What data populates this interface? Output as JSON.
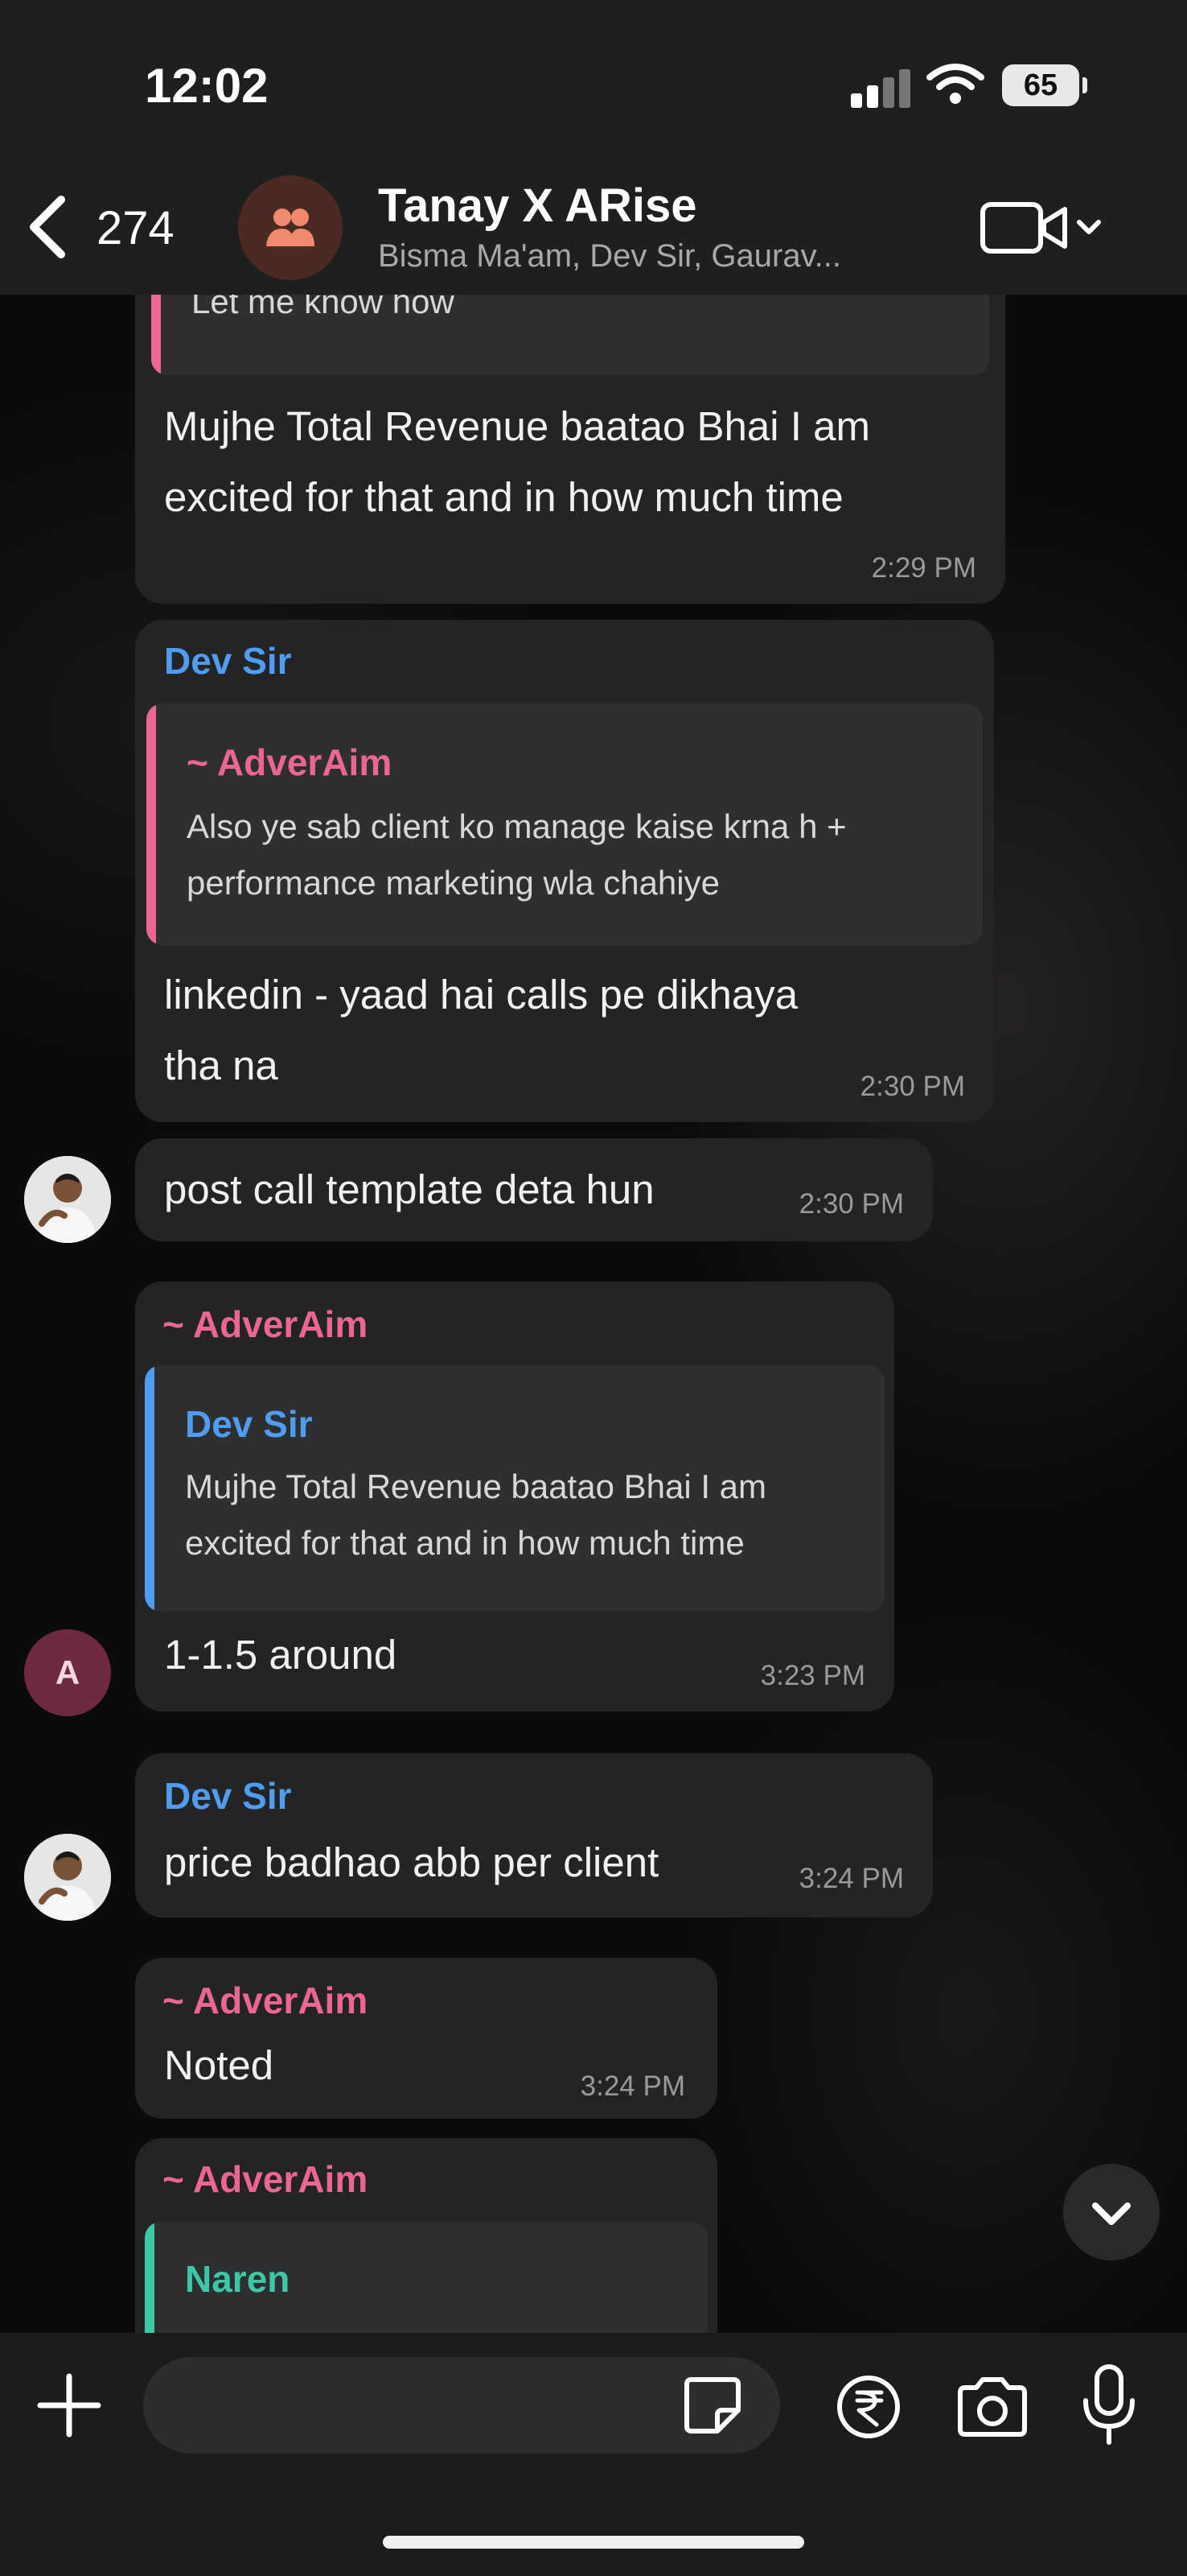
{
  "status_bar": {
    "time": "12:02",
    "battery": "65"
  },
  "header": {
    "back_count": "274",
    "title": "Tanay X ARise",
    "subtitle": "Bisma Ma'am, Dev Sir, Gaurav..."
  },
  "messages": [
    {
      "quote_text": "Let me know how",
      "text_lines": [
        "Mujhe Total Revenue baatao Bhai I am",
        "excited for that and in how much time"
      ],
      "time": "2:29 PM"
    },
    {
      "sender": "Dev Sir",
      "quote_name": "~ AdverAim",
      "quote_lines": [
        "Also ye sab client ko manage kaise krna h +",
        "performance marketing wla chahiye"
      ],
      "text_lines": [
        "linkedin - yaad hai calls pe dikhaya",
        "tha na"
      ],
      "time": "2:30 PM"
    },
    {
      "text": "post call template deta hun",
      "time": "2:30 PM"
    },
    {
      "sender": "~ AdverAim",
      "quote_name": "Dev Sir",
      "quote_lines": [
        "Mujhe Total Revenue baatao Bhai I am",
        "excited for that and in how much time"
      ],
      "text": "1-1.5 around",
      "time": "3:23 PM",
      "avatar_letter": "A"
    },
    {
      "sender": "Dev Sir",
      "text": "price badhao abb per client",
      "time": "3:24 PM"
    },
    {
      "sender": "~ AdverAim",
      "text": "Noted",
      "time": "3:24 PM"
    },
    {
      "sender": "~ AdverAim",
      "quote_name": "Naren"
    }
  ],
  "colors": {
    "blue_sender": "#4f9cf0",
    "pink_sender": "#ec6593",
    "teal_quote": "#3cc7a6",
    "bubble": "#232425"
  },
  "icons": [
    "back-chevron-icon",
    "group-icon",
    "video-call-icon",
    "chevron-down-icon",
    "plus-icon",
    "sticker-icon",
    "rupee-icon",
    "camera-icon",
    "microphone-icon"
  ]
}
